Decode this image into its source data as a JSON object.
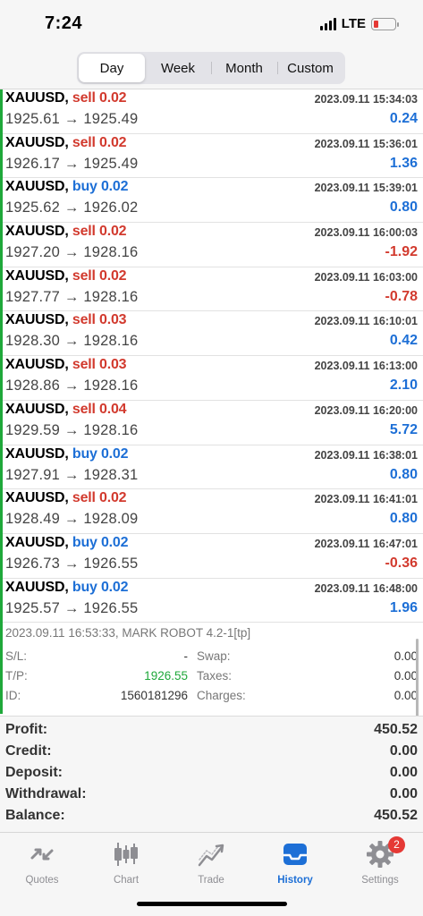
{
  "status": {
    "time": "7:24",
    "network": "LTE",
    "battery_color": "#e53935"
  },
  "period_tabs": {
    "items": [
      "Day",
      "Week",
      "Month",
      "Custom"
    ],
    "active": "Day"
  },
  "deals": [
    {
      "symbol": "XAUUSD",
      "side": "sell",
      "volume": "0.02",
      "time": "2023.09.11 15:34:03",
      "open": "1925.61",
      "close": "1925.49",
      "profit": "0.24"
    },
    {
      "symbol": "XAUUSD",
      "side": "sell",
      "volume": "0.02",
      "time": "2023.09.11 15:36:01",
      "open": "1926.17",
      "close": "1925.49",
      "profit": "1.36"
    },
    {
      "symbol": "XAUUSD",
      "side": "buy",
      "volume": "0.02",
      "time": "2023.09.11 15:39:01",
      "open": "1925.62",
      "close": "1926.02",
      "profit": "0.80"
    },
    {
      "symbol": "XAUUSD",
      "side": "sell",
      "volume": "0.02",
      "time": "2023.09.11 16:00:03",
      "open": "1927.20",
      "close": "1928.16",
      "profit": "-1.92"
    },
    {
      "symbol": "XAUUSD",
      "side": "sell",
      "volume": "0.02",
      "time": "2023.09.11 16:03:00",
      "open": "1927.77",
      "close": "1928.16",
      "profit": "-0.78"
    },
    {
      "symbol": "XAUUSD",
      "side": "sell",
      "volume": "0.03",
      "time": "2023.09.11 16:10:01",
      "open": "1928.30",
      "close": "1928.16",
      "profit": "0.42"
    },
    {
      "symbol": "XAUUSD",
      "side": "sell",
      "volume": "0.03",
      "time": "2023.09.11 16:13:00",
      "open": "1928.86",
      "close": "1928.16",
      "profit": "2.10"
    },
    {
      "symbol": "XAUUSD",
      "side": "sell",
      "volume": "0.04",
      "time": "2023.09.11 16:20:00",
      "open": "1929.59",
      "close": "1928.16",
      "profit": "5.72"
    },
    {
      "symbol": "XAUUSD",
      "side": "buy",
      "volume": "0.02",
      "time": "2023.09.11 16:38:01",
      "open": "1927.91",
      "close": "1928.31",
      "profit": "0.80"
    },
    {
      "symbol": "XAUUSD",
      "side": "sell",
      "volume": "0.02",
      "time": "2023.09.11 16:41:01",
      "open": "1928.49",
      "close": "1928.09",
      "profit": "0.80"
    },
    {
      "symbol": "XAUUSD",
      "side": "buy",
      "volume": "0.02",
      "time": "2023.09.11 16:47:01",
      "open": "1926.73",
      "close": "1926.55",
      "profit": "-0.36"
    },
    {
      "symbol": "XAUUSD",
      "side": "buy",
      "volume": "0.02",
      "time": "2023.09.11 16:48:00",
      "open": "1925.57",
      "close": "1926.55",
      "profit": "1.96"
    }
  ],
  "arrow": "→",
  "expanded_detail": {
    "comment": "2023.09.11 16:53:33, MARK ROBOT 4.2-1[tp]",
    "sl_label": "S/L:",
    "sl_value": "-",
    "tp_label": "T/P:",
    "tp_value": "1926.55",
    "id_label": "ID:",
    "id_value": "1560181296",
    "swap_label": "Swap:",
    "swap_value": "0.00",
    "taxes_label": "Taxes:",
    "taxes_value": "0.00",
    "charges_label": "Charges:",
    "charges_value": "0.00"
  },
  "summary": [
    {
      "label": "Profit:",
      "value": "450.52"
    },
    {
      "label": "Credit:",
      "value": "0.00"
    },
    {
      "label": "Deposit:",
      "value": "0.00"
    },
    {
      "label": "Withdrawal:",
      "value": "0.00"
    },
    {
      "label": "Balance:",
      "value": "450.52"
    }
  ],
  "tabbar": {
    "quotes": "Quotes",
    "chart": "Chart",
    "trade": "Trade",
    "history": "History",
    "settings": "Settings",
    "settings_badge": "2",
    "active": "History",
    "active_color": "#1d6fd6"
  },
  "colors": {
    "buy": "#1d6fd6",
    "sell": "#d23a2e",
    "profit_positive": "#1d6fd6",
    "profit_negative": "#d23a2e",
    "deal_edge": "#1fa83a"
  }
}
